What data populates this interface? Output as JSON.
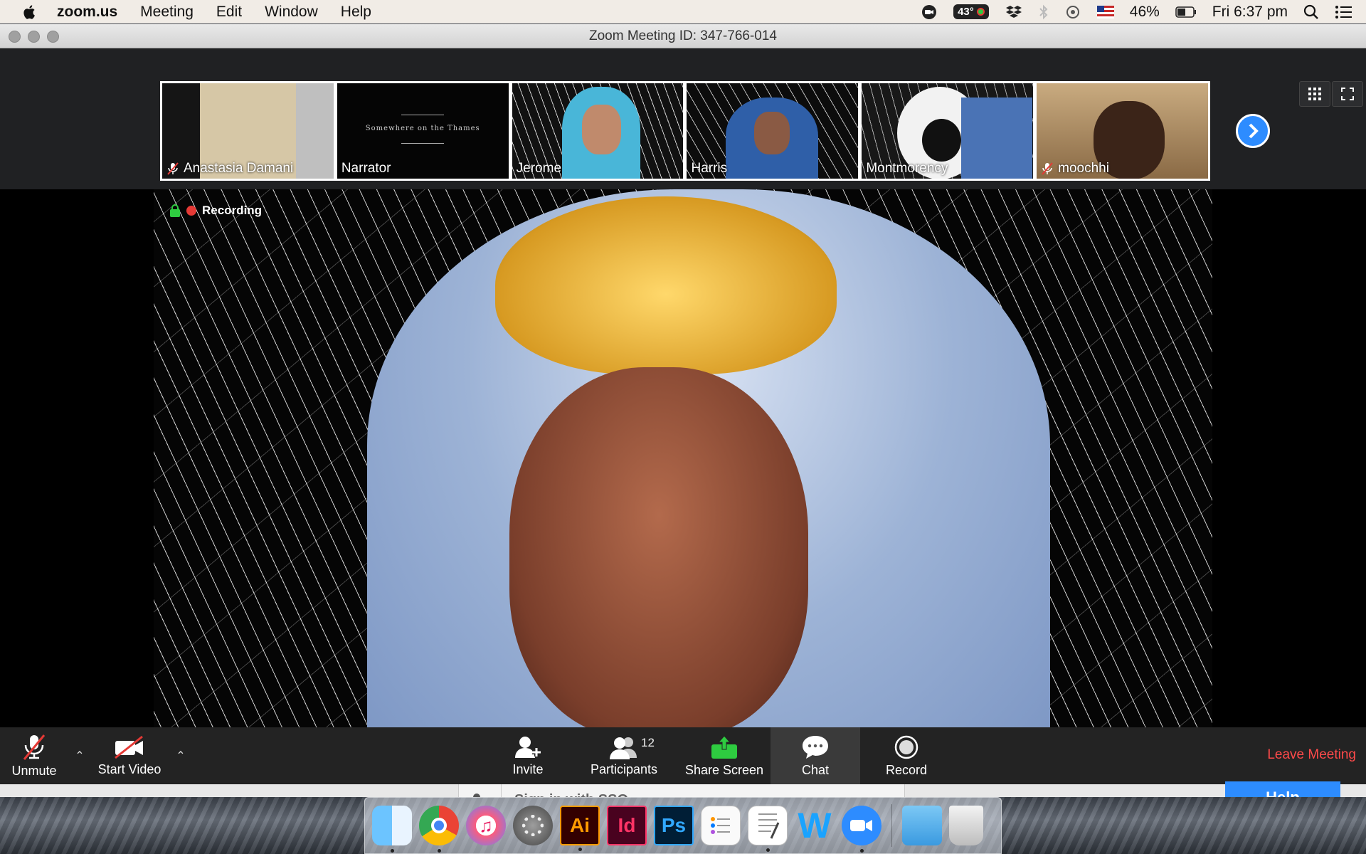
{
  "menubar": {
    "app_name": "zoom.us",
    "menus": [
      "Meeting",
      "Edit",
      "Window",
      "Help"
    ],
    "temperature": "43°",
    "battery": "46%",
    "clock": "Fri 6:37 pm"
  },
  "window": {
    "title": "Zoom Meeting ID: 347-766-014"
  },
  "participants": [
    {
      "name": "Anastasia Damani",
      "muted": true
    },
    {
      "name": "Narrator",
      "muted": false,
      "card_text": "Somewhere on the Thames"
    },
    {
      "name": "Jerome",
      "muted": false
    },
    {
      "name": "Harris",
      "muted": false
    },
    {
      "name": "Montmorency",
      "muted": false
    },
    {
      "name": "moochhi",
      "muted": true
    }
  ],
  "main_video": {
    "recording_label": "Recording"
  },
  "controls": {
    "unmute": "Unmute",
    "start_video": "Start Video",
    "invite": "Invite",
    "participants": "Participants",
    "participant_count": "12",
    "share_screen": "Share Screen",
    "chat": "Chat",
    "record": "Record",
    "leave": "Leave Meeting"
  },
  "behind_window": {
    "sso_text": "Sign in with SSO",
    "help_text": "Help"
  },
  "dock": {
    "apps": [
      "finder-icon",
      "chrome-icon",
      "itunes-icon",
      "system-preferences-icon",
      "illustrator-icon",
      "indesign-icon",
      "photoshop-icon",
      "reminders-icon",
      "textedit-icon",
      "word-icon",
      "zoom-icon",
      "folder-icon",
      "trash-icon"
    ],
    "illustrator_label": "Ai",
    "indesign_label": "Id",
    "photoshop_label": "Ps",
    "word_label": "W"
  },
  "colors": {
    "accent": "#2d8cff",
    "leave": "#ff4a4a",
    "share": "#2ecc40",
    "recording": "#e53935"
  }
}
